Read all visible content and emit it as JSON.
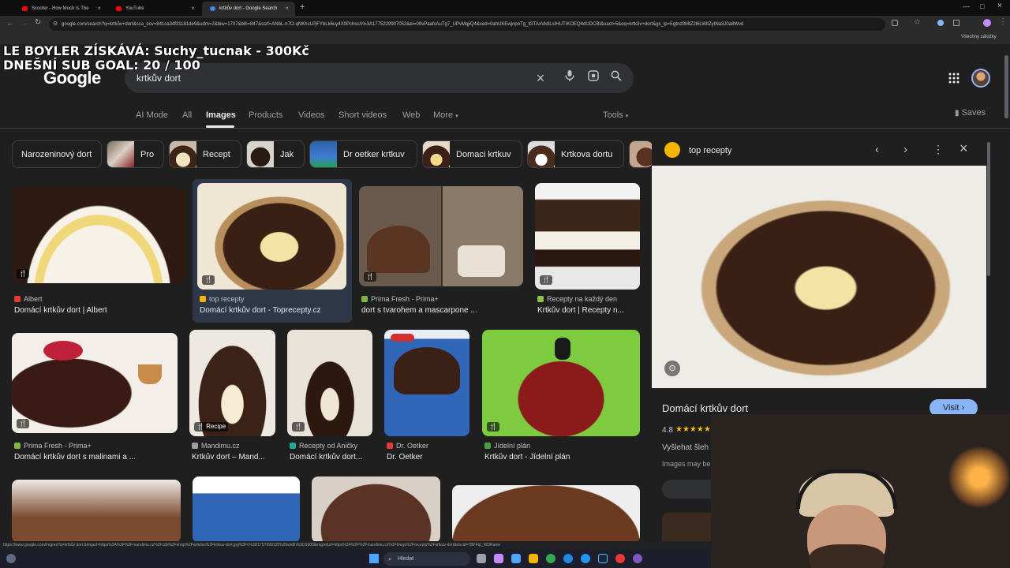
{
  "browser": {
    "tabs": [
      {
        "title": "Scooter - How Much Is The",
        "color": "#ff0000",
        "active": false
      },
      {
        "title": "YouTube",
        "color": "#ff0000",
        "active": false
      },
      {
        "title": "krtkův dort - Google Search",
        "color": "#4285f4",
        "active": true
      }
    ],
    "new_tab": "+",
    "url": "google.com/search?q=krtkův+dort&sca_esv=841ca34f31181de9&udm=2&biw=1707&bih=847&ssrf=ANbL-n7O-qNKhcLPjFYbLk6uy4X0PchscA%3A1775229907052&ei=09vPaafxAuTg7_UPvMqjiQ4&ved=0ahUKEwjnpoTg_tGTAxVk8LsIHUTIKOEQ4dUDCBI&uact=5&oq=krtkův+dort&gs_lp=Egtnd3MtZ2l6LWltZyINa3J0a8Wvd",
    "bookmarks_label": "Všechny záložky"
  },
  "overlay": {
    "line1": "LE BOYLER ZÍSKÁVÁ: Suchy_tucnak - 300Kč",
    "line2": "DNEŠNÍ SUB GOAL: 20 / 100"
  },
  "header": {
    "logo": "Google",
    "query": "krtkův dort",
    "icons": [
      "close-icon",
      "mic-icon",
      "lens-icon",
      "search-icon"
    ],
    "right_icons": [
      "apps-grid-icon",
      "avatar"
    ]
  },
  "nav": {
    "items": [
      "AI Mode",
      "All",
      "Images",
      "Products",
      "Videos",
      "Short videos",
      "Web",
      "More"
    ],
    "active": "Images",
    "tools": "Tools",
    "saves": "Saves"
  },
  "chips": [
    {
      "label": "Narozeninový dort"
    },
    {
      "label": "Pro"
    },
    {
      "label": "Recept"
    },
    {
      "label": "Jak"
    },
    {
      "label": "Dr oetker krtkuv"
    },
    {
      "label": "Domaci krtkuv"
    },
    {
      "label": "Krtkova dortu"
    }
  ],
  "results": [
    {
      "source": "Albert",
      "title": "Domácí krtkův dort | Albert",
      "fav": "#e53935",
      "badge": ""
    },
    {
      "source": "top recepty",
      "title": "Domácí krtkův dort - Toprecepty.cz",
      "fav": "#f4b400",
      "badge": ""
    },
    {
      "source": "Prima Fresh - Prima+",
      "title": "dort s tvarohem a mascarpone ...",
      "fav": "#7cb342",
      "badge": ""
    },
    {
      "source": "Recepty na každý den",
      "title": "Krtkův dort | Recepty n...",
      "fav": "#8bc34a",
      "badge": ""
    },
    {
      "source": "Prima Fresh - Prima+",
      "title": "Domácí krtkův dort s malinami a ...",
      "fav": "#7cb342",
      "badge": ""
    },
    {
      "source": "Mandimu.cz",
      "title": "Krtkův dort – Mand...",
      "fav": "#9e9e9e",
      "badge": "Recipe"
    },
    {
      "source": "Recepty od Aničky",
      "title": "Domácí krtkův dort...",
      "fav": "#26a69a",
      "badge": ""
    },
    {
      "source": "Dr. Oetker",
      "title": "Dr. Oetker",
      "fav": "#e53935",
      "badge": ""
    },
    {
      "source": "Jídelní plán",
      "title": "Krtkův dort - Jídelní plán",
      "fav": "#43a047",
      "badge": ""
    }
  ],
  "panel": {
    "source": "top recepty",
    "title": "Domácí krtkův dort",
    "visit": "Visit",
    "rating": "4.8",
    "stars": "★★★★★",
    "line1": "Vyšlehat šleh",
    "line2": "Images may be"
  },
  "status_url": "https://www.google.com/imgres?q=krtkův dort &imgurl=https%3A%2F%2Fmandimu.cz%2Fcdn%2Fshop%2Farticles%2Fkrtkuv-dort.jpg%3Fv%3D1757690125%26width%3D1600&imgrefurl=https%3A%2F%2Fmandimu.cz%2Fblogs%2Frecepty%2Fkrtkuv-dort&docid=7BFFqt_WDRame",
  "taskbar": {
    "search_placeholder": "Hledat"
  }
}
